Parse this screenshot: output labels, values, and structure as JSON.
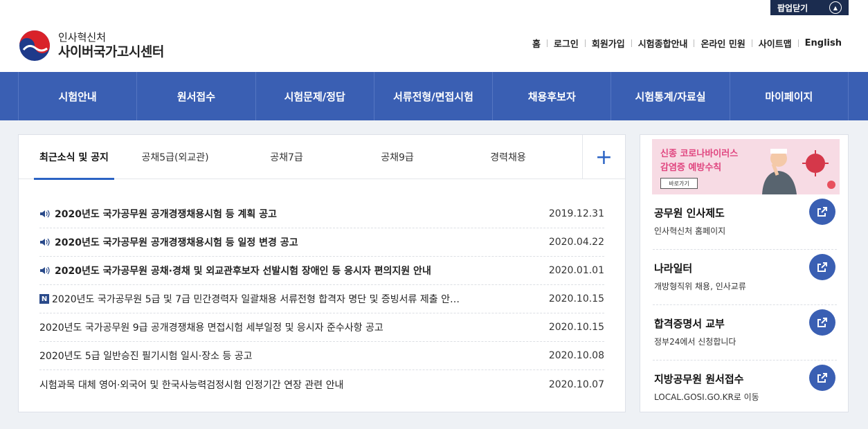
{
  "popup": {
    "close_label": "팝업닫기"
  },
  "logo": {
    "sub": "인사혁신처",
    "main": "사이버국가고시센터"
  },
  "util_links": [
    "홈",
    "로그인",
    "회원가입",
    "시험종합안내",
    "온라인 민원",
    "사이트맵",
    "English"
  ],
  "nav": [
    "시험안내",
    "원서접수",
    "시험문제/정답",
    "서류전형/면접시험",
    "채용후보자",
    "시험통계/자료실",
    "마이페이지"
  ],
  "tabs": [
    "최근소식 및 공지",
    "공채5급(외교관)",
    "공채7급",
    "공채9급",
    "경력채용"
  ],
  "more_label": "+",
  "notices": [
    {
      "title": "2020년도 국가공무원 공개경쟁채용시험 등 계획 공고",
      "date": "2019.12.31",
      "icon": "speaker-icon",
      "bold": true
    },
    {
      "title": "2020년도 국가공무원 공개경쟁채용시험 등 일정 변경 공고",
      "date": "2020.04.22",
      "icon": "speaker-icon",
      "bold": true
    },
    {
      "title": "2020년도 국가공무원 공채·경채 및 외교관후보자 선발시험 장애인 등 응시자 편의지원 안내",
      "date": "2020.01.01",
      "icon": "speaker-icon",
      "bold": true
    },
    {
      "title": "2020년도 국가공무원 5급 및 7급 민간경력자 일괄채용 서류전형 합격자 명단 및 증빙서류 제출 안…",
      "date": "2020.10.15",
      "icon": "new-badge-icon",
      "badge": "N",
      "bold": false
    },
    {
      "title": "2020년도 국가공무원 9급 공개경쟁채용 면접시험 세부일정 및 응시자 준수사항 공고",
      "date": "2020.10.15",
      "icon": "",
      "bold": false
    },
    {
      "title": "2020년도 5급 일반승진 필기시험 일시·장소 등 공고",
      "date": "2020.10.08",
      "icon": "",
      "bold": false
    },
    {
      "title": "시험과목 대체 영어·외국어 및 한국사능력검정시험 인정기간 연장 관련 안내",
      "date": "2020.10.07",
      "icon": "",
      "bold": false
    }
  ],
  "banner": {
    "line1": "신종 코로나바이러스",
    "line2": "감염증 예방수칙",
    "button": "바로가기"
  },
  "side_links": [
    {
      "title": "공무원 인사제도",
      "desc": "인사혁신처 홈페이지"
    },
    {
      "title": "나라일터",
      "desc": "개방형직위 채용, 인사교류"
    },
    {
      "title": "합격증명서 교부",
      "desc": "정부24에서 신청합니다"
    },
    {
      "title": "지방공무원 원서접수",
      "desc": "LOCAL.GOSI.GO.KR로 이동"
    }
  ],
  "colors": {
    "nav_bg": "#3a5fb3",
    "accent": "#2b63c4",
    "popup_bg": "#1b2c4f",
    "banner_text": "#e0457f"
  }
}
